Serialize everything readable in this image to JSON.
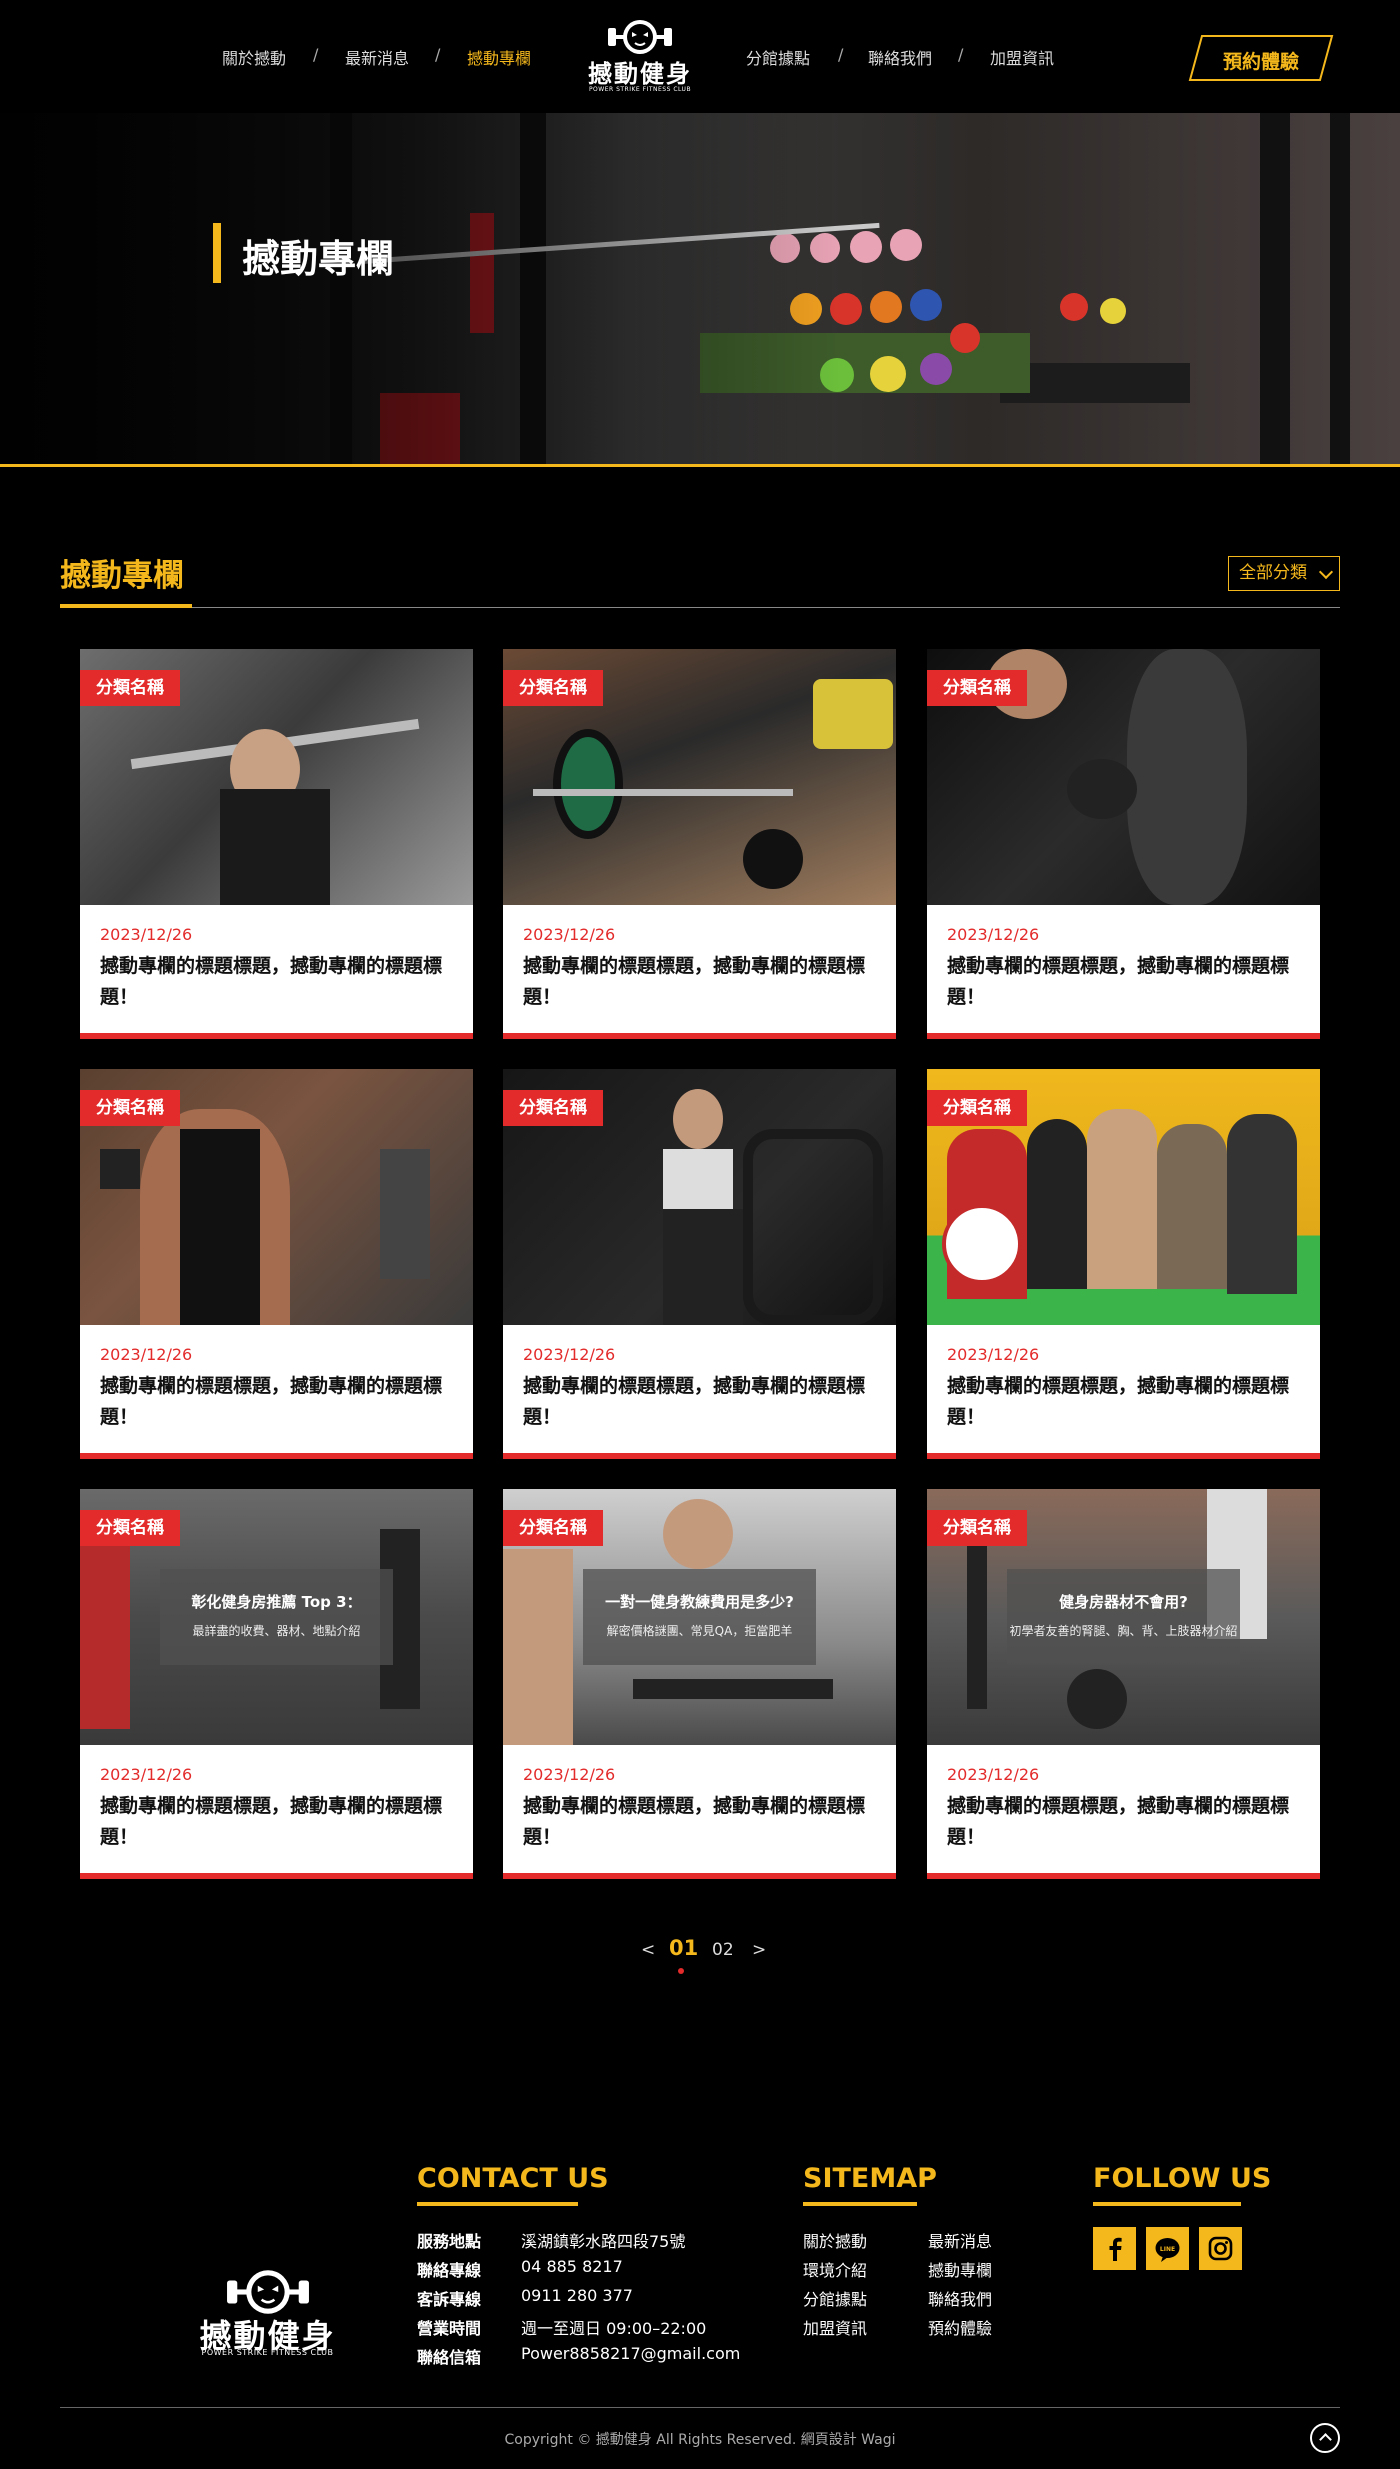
{
  "header": {
    "nav_left": [
      "關於撼動",
      "最新消息",
      "撼動專欄"
    ],
    "nav_right": [
      "分館據點",
      "聯絡我們",
      "加盟資訊"
    ],
    "active": "撼動專欄",
    "separator": "/",
    "logo_text": "撼動健身",
    "logo_sub": "POWER STRIKE FITNESS CLUB",
    "book_label": "預約體驗"
  },
  "banner": {
    "title": "撼動專欄"
  },
  "section": {
    "title": "撼動專欄",
    "filter_label": "全部分類"
  },
  "cards": [
    {
      "tag": "分類名稱",
      "date": "2023/12/26",
      "title": "撼動專欄的標題標題，撼動專欄的標題標題！"
    },
    {
      "tag": "分類名稱",
      "date": "2023/12/26",
      "title": "撼動專欄的標題標題，撼動專欄的標題標題！"
    },
    {
      "tag": "分類名稱",
      "date": "2023/12/26",
      "title": "撼動專欄的標題標題，撼動專欄的標題標題！"
    },
    {
      "tag": "分類名稱",
      "date": "2023/12/26",
      "title": "撼動專欄的標題標題，撼動專欄的標題標題！"
    },
    {
      "tag": "分類名稱",
      "date": "2023/12/26",
      "title": "撼動專欄的標題標題，撼動專欄的標題標題！"
    },
    {
      "tag": "分類名稱",
      "date": "2023/12/26",
      "title": "撼動專欄的標題標題，撼動專欄的標題標題！"
    },
    {
      "tag": "分類名稱",
      "date": "2023/12/26",
      "title": "撼動專欄的標題標題，撼動專欄的標題標題！",
      "overlay_title": "彰化健身房推薦 Top 3：",
      "overlay_sub": "最詳盡的收費、器材、地點介紹"
    },
    {
      "tag": "分類名稱",
      "date": "2023/12/26",
      "title": "撼動專欄的標題標題，撼動專欄的標題標題！",
      "overlay_title": "一對一健身教練費用是多少?",
      "overlay_sub": "解密價格謎團、常見QA，拒當肥羊"
    },
    {
      "tag": "分類名稱",
      "date": "2023/12/26",
      "title": "撼動專欄的標題標題，撼動專欄的標題標題！",
      "overlay_title": "健身房器材不會用?",
      "overlay_sub": "初學者友善的腎腿、胸、背、上肢器材介紹"
    }
  ],
  "pagination": {
    "prev": "<",
    "current": "01",
    "next_page": "02",
    "next": ">"
  },
  "footer": {
    "contact_title": "CONTACT US",
    "contact": [
      {
        "label": "服務地點",
        "value": "溪湖鎮彰水路四段75號"
      },
      {
        "label": "聯絡專線",
        "value": "04 885 8217"
      },
      {
        "label": "客訴專線",
        "value": "0911 280 377"
      },
      {
        "label": "營業時間",
        "value": "週一至週日 09:00–22:00"
      },
      {
        "label": "聯絡信箱",
        "value": "Power8858217@gmail.com"
      }
    ],
    "sitemap_title": "SITEMAP",
    "sitemap_col1": [
      "關於撼動",
      "環境介紹",
      "分館據點",
      "加盟資訊"
    ],
    "sitemap_col2": [
      "最新消息",
      "撼動專欄",
      "聯絡我們",
      "預約體驗"
    ],
    "follow_title": "FOLLOW US",
    "social": [
      "facebook-icon",
      "line-icon",
      "instagram-icon"
    ],
    "copyright": "Copyright © 撼動健身 All Rights Reserved. 網頁設計 Wagi"
  },
  "colors": {
    "accent": "#f5b81c",
    "tag_red": "#e32b2b",
    "background": "#000000"
  }
}
